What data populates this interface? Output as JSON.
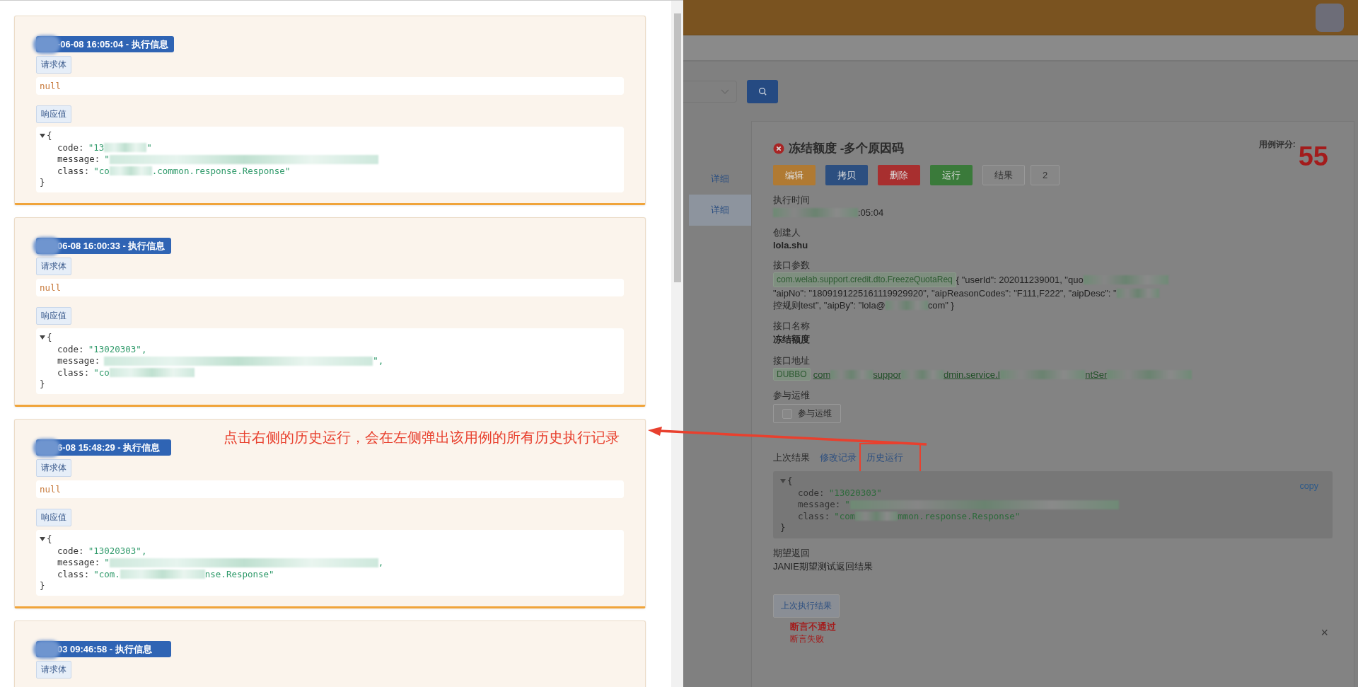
{
  "history_drawer": {
    "records": [
      {
        "time_redacted": true,
        "time": "-06-08 16:05:04 - 执行信息",
        "request_label": "请求体",
        "request_body": "null",
        "response_label": "响应值",
        "response": {
          "expanded": true,
          "open": "{",
          "close": "}",
          "fields": [
            {
              "key": "code:",
              "segments": [
                {
                  "kind": "text",
                  "text": "\"13"
                },
                {
                  "kind": "blur_s"
                },
                {
                  "kind": "text",
                  "text": "\""
                }
              ]
            },
            {
              "key": "message:",
              "segments": [
                {
                  "kind": "text",
                  "text": "\""
                },
                {
                  "kind": "blur_l"
                }
              ]
            },
            {
              "key": "class:",
              "segments": [
                {
                  "kind": "text",
                  "text": "\"co"
                },
                {
                  "kind": "blur_s"
                },
                {
                  "kind": "text",
                  "text": ".common.response.Response\""
                }
              ]
            }
          ]
        }
      },
      {
        "time_redacted": true,
        "time": "06-08 16:00:33 - 执行信息",
        "request_label": "请求体",
        "request_body": "null",
        "response_label": "响应值",
        "response": {
          "expanded": true,
          "open": "{",
          "close": "}",
          "fields": [
            {
              "key": "code:",
              "segments": [
                {
                  "kind": "text",
                  "text": "\"13020303\","
                }
              ]
            },
            {
              "key": "message:",
              "segments": [
                {
                  "kind": "blur_l"
                },
                {
                  "kind": "text",
                  "text": "\","
                }
              ]
            },
            {
              "key": "class:",
              "segments": [
                {
                  "kind": "text",
                  "text": "\"co"
                },
                {
                  "kind": "blur_m"
                }
              ]
            }
          ]
        }
      },
      {
        "time_redacted": true,
        "time": "6-08 15:48:29 - 执行信息",
        "request_label": "请求体",
        "request_body": "null",
        "response_label": "响应值",
        "response": {
          "expanded": true,
          "open": "{",
          "close": "}",
          "fields": [
            {
              "key": "code:",
              "segments": [
                {
                  "kind": "text",
                  "text": "\"13020303\","
                }
              ]
            },
            {
              "key": "message:",
              "segments": [
                {
                  "kind": "text",
                  "text": "\""
                },
                {
                  "kind": "blur_l"
                },
                {
                  "kind": "text",
                  "text": ","
                }
              ]
            },
            {
              "key": "class:",
              "segments": [
                {
                  "kind": "text",
                  "text": "\"com."
                },
                {
                  "kind": "blur_m"
                },
                {
                  "kind": "text",
                  "text": "nse.Response\""
                }
              ]
            }
          ]
        }
      },
      {
        "time_redacted": true,
        "time": "03 09:46:58 - 执行信息",
        "request_label": "请求体"
      }
    ]
  },
  "annotation": {
    "text": "点击右侧的历史运行，会在左侧弹出该用例的所有历史执行记录"
  },
  "sidebar_links": [
    {
      "label": "详细",
      "selected": false
    },
    {
      "label": "详细",
      "selected": true
    }
  ],
  "case": {
    "passed": false,
    "title": "冻结额度 -多个原因码",
    "score_label": "用例评分:",
    "score": "55",
    "buttons": [
      {
        "label": "编辑",
        "kind": "warning"
      },
      {
        "label": "拷贝",
        "kind": "primary"
      },
      {
        "label": "删除",
        "kind": "danger"
      },
      {
        "label": "运行",
        "kind": "success"
      },
      {
        "label": "结果",
        "kind": "default"
      },
      {
        "label": "2",
        "kind": "default"
      }
    ],
    "exec_time": {
      "label": "执行时间",
      "segments": [
        {
          "kind": "blur_m"
        },
        {
          "kind": "text",
          "text": ":05:04"
        }
      ]
    },
    "creator": {
      "label": "创建人",
      "value": "lola.shu"
    },
    "params": {
      "label": "接口参数",
      "tag": "com.welab.support.credit.dto.FreezeQuotaReq",
      "segments": [
        {
          "kind": "text",
          "text": "{ \"userId\": 202011239001, \"quo"
        },
        {
          "kind": "blur_m"
        },
        {
          "kind": "text",
          "text": " \"aipNo\": \"1809191225161119929920\", \"aipReasonCodes\": \"F111,F222\", \"aipDesc\": \""
        },
        {
          "kind": "blur_s"
        },
        {
          "kind": "text",
          "text": " 控规则test\", \"aipBy\": \"lola@"
        },
        {
          "kind": "blur_s"
        },
        {
          "kind": "text",
          "text": "com\" }"
        }
      ]
    },
    "api_name": {
      "label": "接口名称",
      "value": "冻结额度"
    },
    "api_address": {
      "label": "接口地址",
      "tag": "DUBBO",
      "segments": [
        {
          "kind": "text",
          "text": "com"
        },
        {
          "kind": "blur_s"
        },
        {
          "kind": "text",
          "text": "suppor"
        },
        {
          "kind": "blur_s"
        },
        {
          "kind": "text",
          "text": "dmin.service.I"
        },
        {
          "kind": "blur_m"
        },
        {
          "kind": "text",
          "text": "ntSer"
        },
        {
          "kind": "blur_m"
        }
      ]
    },
    "ops": {
      "label": "参与运维",
      "checkbox_label": "参与运维",
      "checked": false
    },
    "tabs": [
      {
        "label": "上次结果",
        "selected": true
      },
      {
        "label": "修改记录",
        "selected": false
      },
      {
        "label": "历史运行",
        "selected": false,
        "highlighted": true
      }
    ],
    "result": {
      "copy": "copy",
      "expanded": true,
      "open": "{",
      "close": "}",
      "fields": [
        {
          "key": "code:",
          "segments": [
            {
              "kind": "text",
              "text": "\"13020303\""
            }
          ]
        },
        {
          "key": "message:",
          "segments": [
            {
              "kind": "text",
              "text": "\""
            },
            {
              "kind": "blur_l"
            }
          ]
        },
        {
          "key": "class:",
          "segments": [
            {
              "kind": "text",
              "text": "\"com"
            },
            {
              "kind": "blur_s"
            },
            {
              "kind": "text",
              "text": "mmon.response.Response\""
            }
          ]
        }
      ]
    },
    "expected": {
      "label": "期望返回",
      "value": "JANIE期望测试返回结果"
    },
    "last_result_button": "上次执行结果",
    "assertion": {
      "title": "断言不通过",
      "detail": "断言失败"
    },
    "close": "×"
  }
}
